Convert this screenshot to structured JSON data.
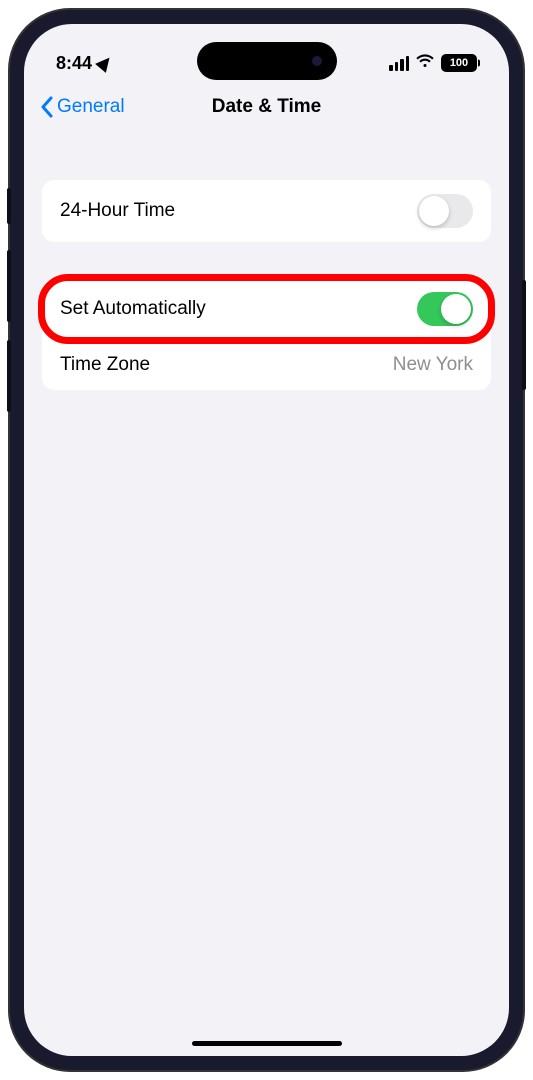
{
  "status_bar": {
    "time": "8:44",
    "battery_level": "100"
  },
  "nav": {
    "back_label": "General",
    "title": "Date & Time"
  },
  "settings": {
    "group1": {
      "row1": {
        "label": "24-Hour Time"
      }
    },
    "group2": {
      "row1": {
        "label": "Set Automatically"
      },
      "row2": {
        "label": "Time Zone",
        "value": "New York"
      }
    }
  }
}
